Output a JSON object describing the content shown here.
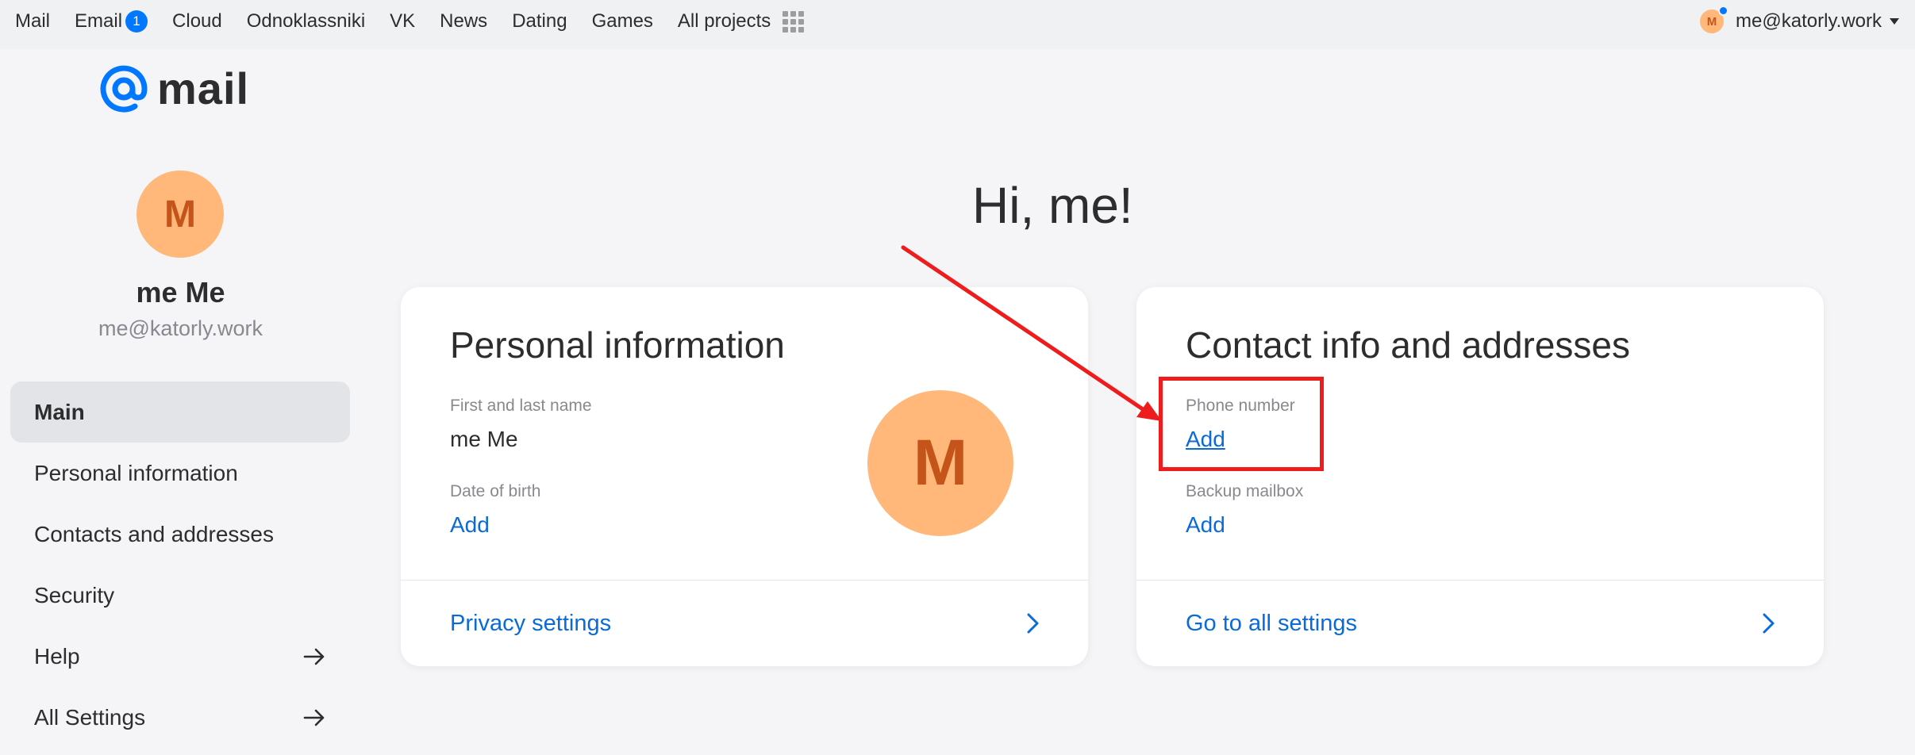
{
  "topbar": {
    "nav": [
      {
        "label": "Mail"
      },
      {
        "label": "Email",
        "badge": "1"
      },
      {
        "label": "Cloud"
      },
      {
        "label": "Odnoklassniki"
      },
      {
        "label": "VK"
      },
      {
        "label": "News"
      },
      {
        "label": "Dating"
      },
      {
        "label": "Games"
      },
      {
        "label": "All projects"
      }
    ],
    "apps_icon": "grid-icon",
    "account": {
      "avatar_letter": "M",
      "email": "me@katorly.work"
    }
  },
  "logo": {
    "text": "mail"
  },
  "sidebar": {
    "avatar_letter": "M",
    "name": "me Me",
    "email": "me@katorly.work",
    "items": [
      {
        "label": "Main",
        "active": true
      },
      {
        "label": "Personal information"
      },
      {
        "label": "Contacts and addresses"
      },
      {
        "label": "Security"
      },
      {
        "label": "Help",
        "icon": "arrow-right-icon"
      },
      {
        "label": "All Settings",
        "icon": "arrow-right-icon"
      }
    ]
  },
  "main": {
    "greeting": "Hi, me!",
    "personal_card": {
      "title": "Personal information",
      "name_label": "First and last name",
      "name_value": "me Me",
      "dob_label": "Date of birth",
      "dob_action": "Add",
      "avatar_letter": "M",
      "footer_link": "Privacy settings"
    },
    "contact_card": {
      "title": "Contact info and addresses",
      "phone_label": "Phone number",
      "phone_action": "Add",
      "backup_label": "Backup mailbox",
      "backup_action": "Add",
      "footer_link": "Go to all settings"
    }
  },
  "colors": {
    "accent": "#0a6bd8",
    "badge": "#0077ff",
    "avatar_bg": "#ffb87a",
    "avatar_fg": "#c5541a",
    "annotation": "#ee1c1c"
  }
}
